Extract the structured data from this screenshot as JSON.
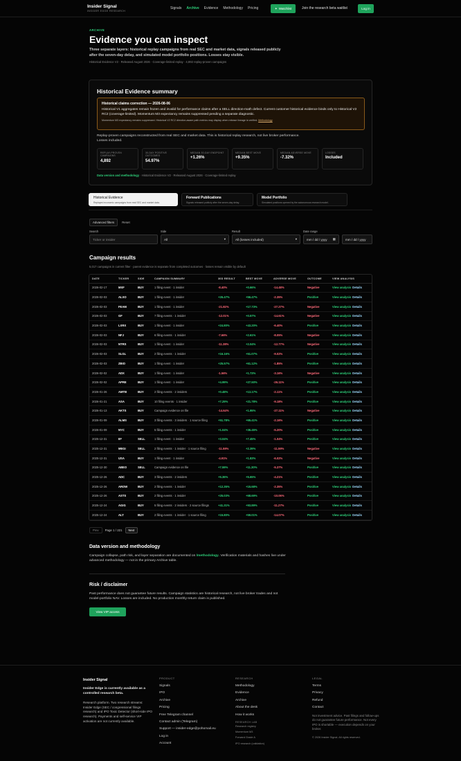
{
  "nav": {
    "brand": "Insider Signal",
    "brand_sub": "INSIDER EDGE RESEARCH",
    "links": [
      "Signals",
      "Archive",
      "Evidence",
      "Methodology",
      "Pricing"
    ],
    "watchlist": "Watchlist",
    "waitlist": "Join the research beta waitlist",
    "login": "Log in"
  },
  "hero": {
    "eyebrow": "ARCHIVE",
    "title": "Evidence you can inspect",
    "desc": "Three separate layers: historical replay campaigns from real SEC and market data, signals released publicly after the seven-day delay, and simulated model portfolio positions. Losses stay visible.",
    "meta": "Historical Evidence V2 · Released August 2026 · Coverage-limited replay · 4,892 replay-proven campaigns"
  },
  "summary": {
    "title": "Historical Evidence summary",
    "correction_title": "Historical claims correction — 2026-08-06",
    "correction_body": "Historical V1 aggregates remain frozen and invalid for performance claims after a SELL direction-math defect. Current customer historical evidence binds only to Historical V2 RC2 (coverage-limited). Momentum M3 expectancy remains suppressed pending a separate diagnostic.",
    "correction_note": "Momentum M3 expectancy remains suppressed. Historical V2 RC2 direction-aware path metrics may display when release lineage is verified.",
    "correction_link": "Methodology",
    "desc": "Replay-proven campaigns reconstructed from real SEC and market data. This is historical replay research, not live broker performance. Losses included.",
    "stats": [
      {
        "label": "REPLAY-PROVEN CAMPAIGNS",
        "value": "4,892"
      },
      {
        "label": "30-DAY POSITIVE OUTCOMES",
        "value": "54.97%"
      },
      {
        "label": "MEDIAN 30-DAY ENDPOINT",
        "value": "+1.26%"
      },
      {
        "label": "MEDIAN BEST MOVE",
        "value": "+9.35%"
      },
      {
        "label": "MEDIAN ADVERSE MOVE",
        "value": "-7.32%"
      },
      {
        "label": "LOSSES",
        "value": "Included"
      }
    ],
    "version_label": "Data version and methodology",
    "version_text": " · Historical Evidence V2 · Released August 2026 · Coverage-limited replay"
  },
  "tabs": [
    {
      "title": "Historical Evidence",
      "sub": "Replayed economic campaigns from real SEC and market data."
    },
    {
      "title": "Forward Publications",
      "sub": "Signals released publicly after the seven-day delay."
    },
    {
      "title": "Model Portfolio",
      "sub": "Simulated positions opened by the autonomous research model."
    }
  ],
  "filters": {
    "advanced": "Advanced filters",
    "reset": "Reset",
    "search_label": "Search",
    "search_placeholder": "Ticker or insider",
    "side_label": "Side",
    "side_value": "All",
    "result_label": "Result",
    "result_value": "All (losses included)",
    "date_label": "Date range",
    "date_from": "mm / dd / yyyy",
    "date_to": "mm / dd / yyyy"
  },
  "results": {
    "title": "Campaign results",
    "meta": "5,017 campaigns in current filter · parent evidence is separate from completed outcomes · losses remain visible by default",
    "columns": [
      "DATE",
      "TICKER",
      "SIDE",
      "CAMPAIGN SUMMARY",
      "30D RESULT",
      "BEST MOVE",
      "ADVERSE MOVE",
      "OUTCOME",
      "VIEW ANALYSIS"
    ],
    "view_label": "View analysis",
    "details_label": "Details",
    "rows": [
      [
        "2026-02-17",
        "MXF",
        "BUY",
        "1 filing event · 1 insider",
        "-8.40%",
        "+0.66%",
        "-14.48%",
        "Negative"
      ],
      [
        "2026-02-03",
        "ALXO",
        "BUY",
        "1 filing event · 1 insider",
        "+26.47%",
        "+56.47%",
        "-2.35%",
        "Positive"
      ],
      [
        "2026-02-03",
        "FEAM",
        "BUY",
        "1 filing event · 1 insider",
        "-21.82%",
        "+17.73%",
        "-27.27%",
        "Negative"
      ],
      [
        "2026-02-03",
        "GF",
        "BUY",
        "7 filing events · 1 insider",
        "-12.01%",
        "+0.57%",
        "-14.61%",
        "Negative"
      ],
      [
        "2026-02-03",
        "LXRX",
        "BUY",
        "1 filing event · 1 insider",
        "+24.80%",
        "+43.20%",
        "-6.40%",
        "Positive"
      ],
      [
        "2026-02-03",
        "NFJ",
        "BUY",
        "6 filing events · 1 insider",
        "-7.66%",
        "+2.61%",
        "-8.05%",
        "Negative"
      ],
      [
        "2026-02-03",
        "NTRS",
        "BUY",
        "1 filing event · 1 insider",
        "-11.38%",
        "+2.04%",
        "-12.77%",
        "Negative"
      ],
      [
        "2026-02-03",
        "SLGL",
        "BUY",
        "2 filing events · 1 insider",
        "+16.16%",
        "+51.07%",
        "-9.02%",
        "Positive"
      ],
      [
        "2026-02-03",
        "ZBIO",
        "BUY",
        "1 filing event · 1 insider",
        "+25.57%",
        "+61.12%",
        "-1.85%",
        "Positive"
      ],
      [
        "2026-02-02",
        "ADX",
        "BUY",
        "1 filing event · 1 insider",
        "-1.56%",
        "+1.73%",
        "-3.16%",
        "Negative"
      ],
      [
        "2026-02-02",
        "APRE",
        "BUY",
        "1 filing event · 1 insider",
        "+4.99%",
        "+27.50%",
        "-26.11%",
        "Positive"
      ],
      [
        "2026-01-26",
        "AMTB",
        "BUY",
        "2 filing events · 2 insiders",
        "+0.48%",
        "+13.17%",
        "-2.11%",
        "Positive"
      ],
      [
        "2026-01-21",
        "ASA",
        "BUY",
        "10 filing events · 1 insider",
        "+7.29%",
        "+21.78%",
        "-9.18%",
        "Positive"
      ],
      [
        "2026-01-13",
        "AKTS",
        "BUY",
        "Campaign evidence on file",
        "-14.64%",
        "+1.95%",
        "-27.11%",
        "Negative"
      ],
      [
        "2026-01-09",
        "ALMS",
        "BUY",
        "3 filing events · 3 insiders · 1 source filing",
        "+51.78%",
        "+65.41%",
        "-2.16%",
        "Positive"
      ],
      [
        "2026-01-09",
        "NYC",
        "BUY",
        "5 filing events · 1 insider",
        "+1.04%",
        "+36.45%",
        "-5.20%",
        "Positive"
      ],
      [
        "2025-12-31",
        "IIF",
        "SELL",
        "1 filing event · 1 insider",
        "+3.04%",
        "+7.45%",
        "-1.04%",
        "Positive"
      ],
      [
        "2025-12-31",
        "MEGI",
        "SELL",
        "2 filing events · 1 insider · 1 source filing",
        "-11.59%",
        "+2.39%",
        "-11.59%",
        "Negative"
      ],
      [
        "2025-12-31",
        "USA",
        "BUY",
        "1 filing event · 1 insider",
        "-4.91%",
        "+1.83%",
        "-6.02%",
        "Negative"
      ],
      [
        "2025-12-30",
        "ABEO",
        "SELL",
        "Campaign evidence on file",
        "+7.59%",
        "+11.30%",
        "-5.37%",
        "Positive"
      ],
      [
        "2025-12-26",
        "ADC",
        "BUY",
        "3 filing events · 2 insiders",
        "+5.36%",
        "+5.65%",
        "-4.21%",
        "Positive"
      ],
      [
        "2025-12-26",
        "AROW",
        "BUY",
        "2 filing events · 1 insider",
        "+12.35%",
        "+15.68%",
        "-2.35%",
        "Positive"
      ],
      [
        "2025-12-26",
        "ASTS",
        "BUY",
        "2 filing events · 1 insider",
        "+25.03%",
        "+68.69%",
        "-10.06%",
        "Positive"
      ],
      [
        "2025-12-24",
        "AGIG",
        "BUY",
        "5 filing events · 2 insiders · 2 source filings",
        "+41.31%",
        "+93.89%",
        "-11.27%",
        "Positive"
      ],
      [
        "2025-12-24",
        "ALT",
        "BUY",
        "2 filing events · 1 insider · 1 source filing",
        "+15.80%",
        "+59.01%",
        "-14.07%",
        "Positive"
      ]
    ]
  },
  "pager": {
    "prev": "Prev",
    "text": "Page 1 / 221",
    "next": "Next"
  },
  "methodology": {
    "title": "Data version and methodology",
    "text_before": "Campaign collapse, path risk, and layer separation are documented on ",
    "link": "/methodology",
    "text_after": ". Verification materials and hashes live under advanced methodology — not in the primary Archive table."
  },
  "risk": {
    "title": "Risk / disclaimer",
    "text": "Past performance does not guarantee future results. Campaign statistics are historical research, not live broker trades and not model-portfolio NAV. Losses are included. No production monthly-return claim is published.",
    "cta": "View VIP access"
  },
  "footer": {
    "brand": "Insider Signal",
    "status": "Insider Edge is currently available as a controlled research beta.",
    "desc": "Research platform. Two research streams: Insider Edge (SEC / congressional filings research) and IPO Toxic Detector (short-side IPO research). Payments and self-service VIP activation are not currently available.",
    "product_h": "PRODUCT",
    "product_links": [
      "Signals",
      "IPO",
      "Archive",
      "Pricing",
      "Free Telegram channel",
      "Contact admin (Telegram)",
      "Support — insider-edge@pohomail.eu",
      "Log in",
      "Account"
    ],
    "research_h": "RESEARCH",
    "research_links": [
      "Methodology",
      "Evidence",
      "Archive",
      "About the desk",
      "How it works"
    ],
    "lab_h": "RESEARCH LAB",
    "lab_links": [
      "Research registry",
      "Momentum M3",
      "Forward Grade A",
      "IPO research (validation)"
    ],
    "legal_h": "LEGAL",
    "legal_links": [
      "Terms",
      "Privacy",
      "Refund",
      "Contact"
    ],
    "legal_text": "Not investment advice. Past filings and follow-ups do not guarantee future performance. Not every IPO is shortable — execution depends on your broker.",
    "copy": "© 2026 Insider Signal. All rights reserved."
  }
}
